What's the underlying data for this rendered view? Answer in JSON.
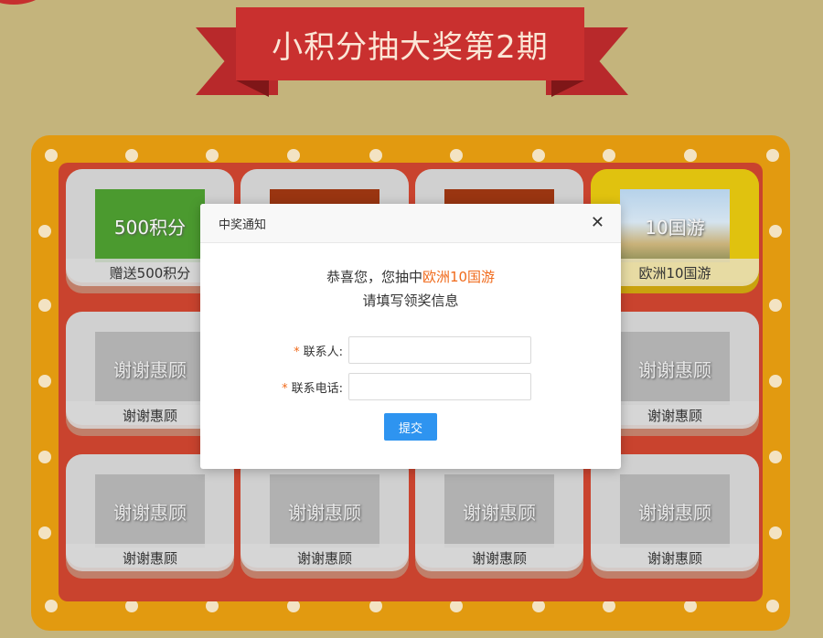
{
  "banner": {
    "title": "小积分抽大奖第2期"
  },
  "prizes": [
    {
      "image_text": "500积分",
      "label": "赠送500积分",
      "style": "green"
    },
    {
      "image_text": "",
      "label": "",
      "style": "brown"
    },
    {
      "image_text": "",
      "label": "",
      "style": "brown"
    },
    {
      "image_text": "10国游",
      "label": "欧洲10国游",
      "style": "travel",
      "active": true
    },
    {
      "image_text": "谢谢惠顾",
      "label": "谢谢惠顾",
      "style": "gray"
    },
    {
      "image_text": "谢谢惠顾",
      "label": "谢谢惠顾",
      "style": "gray"
    },
    {
      "image_text": "谢谢惠顾",
      "label": "谢谢惠顾",
      "style": "gray"
    },
    {
      "image_text": "谢谢惠顾",
      "label": "谢谢惠顾",
      "style": "gray"
    },
    {
      "image_text": "谢谢惠顾",
      "label": "谢谢惠顾",
      "style": "gray"
    },
    {
      "image_text": "谢谢惠顾",
      "label": "谢谢惠顾",
      "style": "gray"
    }
  ],
  "modal": {
    "title": "中奖通知",
    "close_icon": "close-icon",
    "congrats_prefix": "恭喜您，您抽中",
    "prize_name": "欧洲10国游",
    "instruction": "请填写领奖信息",
    "fields": [
      {
        "label": "联系人:",
        "value": "",
        "placeholder": ""
      },
      {
        "label": "联系电话:",
        "value": "",
        "placeholder": ""
      }
    ],
    "submit_label": "提交"
  },
  "colors": {
    "background": "#c4b47c",
    "ribbon": "#c9302f",
    "board_outer": "#e29a10",
    "board_inner": "#c9432e",
    "highlight": "#f06a1b",
    "submit": "#2e94f0"
  }
}
